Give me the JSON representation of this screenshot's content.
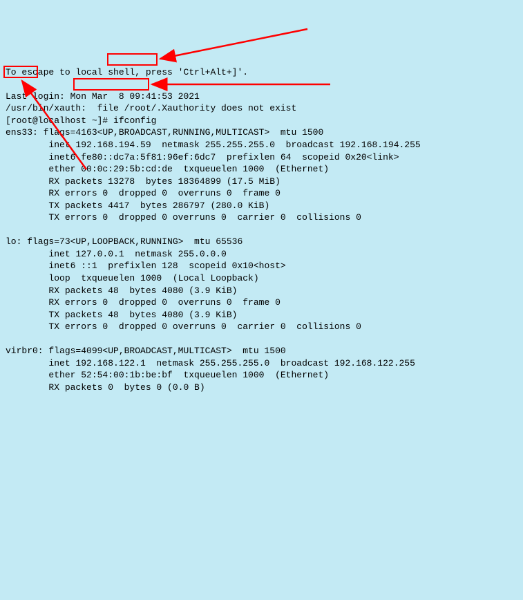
{
  "terminal": {
    "escape_hint": "To escape to local shell, press 'Ctrl+Alt+]'.",
    "blank1": "",
    "last_login": "Last login: Mon Mar  8 09:41:53 2021",
    "xauth": "/usr/bin/xauth:  file /root/.Xauthority does not exist",
    "prompt_prefix": "[root@localhost ~]#",
    "command": " ifconfig",
    "ens33_header_iface": "ens33:",
    "ens33_header_rest": " flags=4163<UP,BROADCAST,RUNNING,MULTICAST>  mtu 1500",
    "ens33_inet_prefix": "        inet ",
    "ens33_ip": "192.168.194.59",
    "ens33_inet_suffix": "  netmask 255.255.255.0  broadcast 192.168.194.255",
    "ens33_inet6": "        inet6 fe80::dc7a:5f81:96ef:6dc7  prefixlen 64  scopeid 0x20<link>",
    "ens33_ether": "        ether 00:0c:29:5b:cd:de  txqueuelen 1000  (Ethernet)",
    "ens33_rx_packets": "        RX packets 13278  bytes 18364899 (17.5 MiB)",
    "ens33_rx_errors": "        RX errors 0  dropped 0  overruns 0  frame 0",
    "ens33_tx_packets": "        TX packets 4417  bytes 286797 (280.0 KiB)",
    "ens33_tx_errors": "        TX errors 0  dropped 0 overruns 0  carrier 0  collisions 0",
    "blank2": "",
    "lo_header": "lo: flags=73<UP,LOOPBACK,RUNNING>  mtu 65536",
    "lo_inet": "        inet 127.0.0.1  netmask 255.0.0.0",
    "lo_inet6": "        inet6 ::1  prefixlen 128  scopeid 0x10<host>",
    "lo_loop": "        loop  txqueuelen 1000  (Local Loopback)",
    "lo_rx_packets": "        RX packets 48  bytes 4080 (3.9 KiB)",
    "lo_rx_errors": "        RX errors 0  dropped 0  overruns 0  frame 0",
    "lo_tx_packets": "        TX packets 48  bytes 4080 (3.9 KiB)",
    "lo_tx_errors": "        TX errors 0  dropped 0 overruns 0  carrier 0  collisions 0",
    "blank3": "",
    "virbr0_header": "virbr0: flags=4099<UP,BROADCAST,MULTICAST>  mtu 1500",
    "virbr0_inet": "        inet 192.168.122.1  netmask 255.255.255.0  broadcast 192.168.122.255",
    "virbr0_ether": "        ether 52:54:00:1b:be:bf  txqueuelen 1000  (Ethernet)",
    "virbr0_rx_packets": "        RX packets 0  bytes 0 (0.0 B)"
  },
  "annotations": {
    "box_command": "ifconfig-command-highlight",
    "box_interface": "ens33-interface-highlight",
    "box_ip": "ip-address-highlight",
    "arrow_color": "#ff0000"
  }
}
